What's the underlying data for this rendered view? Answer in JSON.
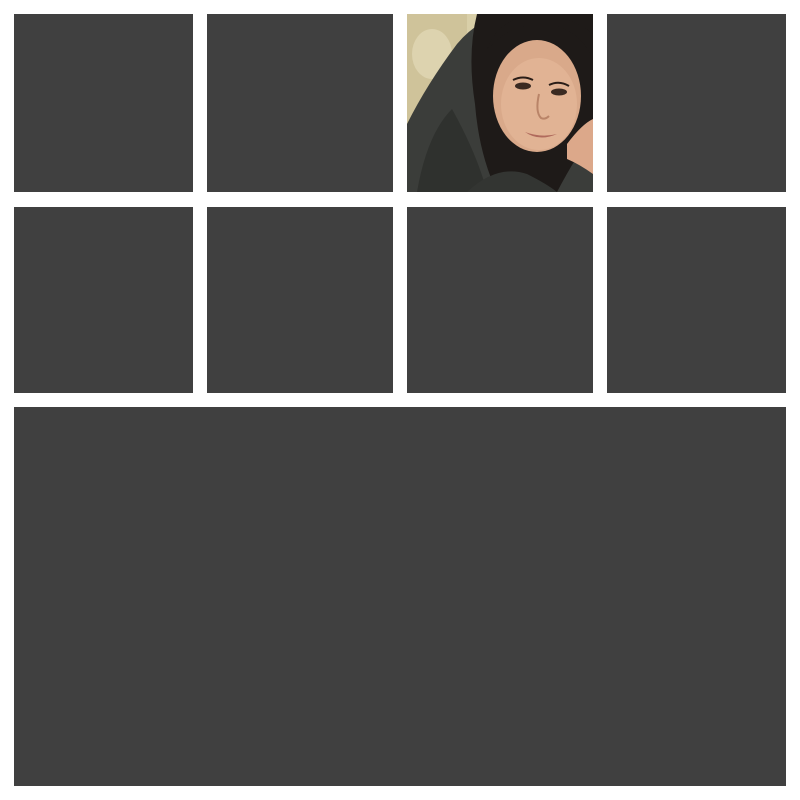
{
  "collage": {
    "background_color": "#ffffff",
    "empty_slot_color": "#404040",
    "slots": [
      {
        "id": "slot-1",
        "state": "empty"
      },
      {
        "id": "slot-2",
        "state": "empty"
      },
      {
        "id": "slot-3",
        "state": "filled",
        "content": "portrait photo"
      },
      {
        "id": "slot-4",
        "state": "empty"
      },
      {
        "id": "slot-5",
        "state": "empty"
      },
      {
        "id": "slot-6",
        "state": "empty"
      },
      {
        "id": "slot-7",
        "state": "empty"
      },
      {
        "id": "slot-8",
        "state": "empty"
      },
      {
        "id": "slot-9",
        "state": "empty"
      }
    ]
  }
}
